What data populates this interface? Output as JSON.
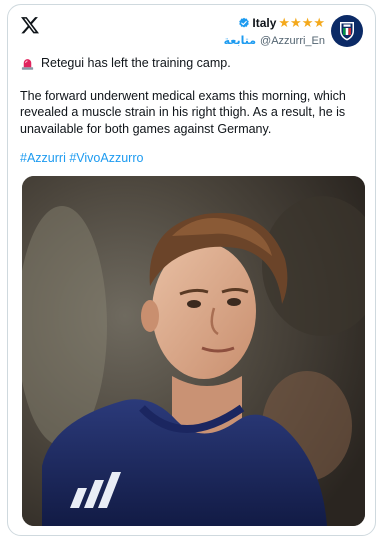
{
  "header": {
    "logo_icon": "x-logo-icon",
    "account_name": "Italy",
    "rating_stars": 4,
    "follow_label": "متابعة",
    "handle": "@Azzurri_En",
    "verified_icon": "verified-badge-icon",
    "avatar_icon": "figc-crest-icon"
  },
  "post": {
    "emoji_icon": "rotating-light-icon",
    "line1": "Retegui has left the training camp.",
    "paragraph2": "The forward underwent medical exams this morning, which revealed a muscle strain in his right thigh. As a result, he is unavailable for both games against Germany.",
    "hashtags": [
      "#Azzurri",
      "#VivoAzzurro"
    ]
  },
  "media": {
    "icon": "player-photo"
  },
  "colors": {
    "link": "#1d9bf0",
    "star": "#f4a91c",
    "border": "#cfd9de",
    "avatar_bg": "#0b2a66"
  }
}
